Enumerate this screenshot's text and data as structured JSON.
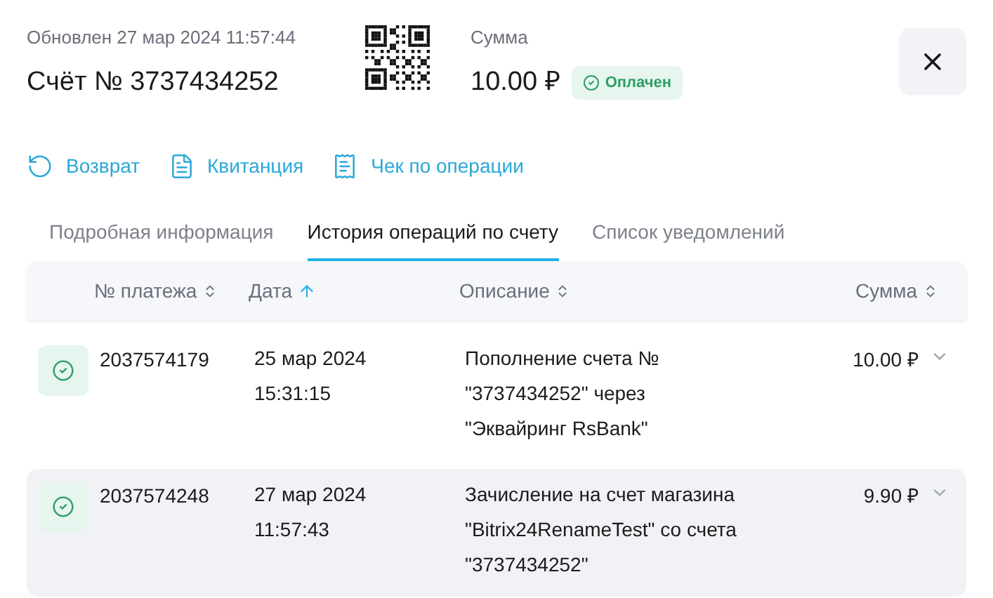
{
  "header": {
    "updated": "Обновлен 27 мар 2024 11:57:44",
    "title": "Счёт № 3737434252",
    "amount_label": "Сумма",
    "amount": "10.00 ₽",
    "status": "Оплачен"
  },
  "actions": [
    {
      "kind": "refund",
      "label": "Возврат"
    },
    {
      "kind": "receipt",
      "label": "Квитанция"
    },
    {
      "kind": "check",
      "label": "Чек по операции"
    }
  ],
  "tabs": [
    {
      "label": "Подробная информация",
      "selected": false
    },
    {
      "label": "История операций по счету",
      "selected": true
    },
    {
      "label": "Список уведомлений",
      "selected": false
    }
  ],
  "table": {
    "columns": [
      {
        "label": "№ платежа",
        "sorted": false
      },
      {
        "label": "Дата",
        "sorted": true
      },
      {
        "label": "Описание",
        "sorted": false
      },
      {
        "label": "Сумма",
        "sorted": false
      }
    ],
    "rows": [
      {
        "number": "2037574179",
        "date": "25 мар 2024",
        "time": "15:31:15",
        "description": "Пополнение счета № \"3737434252\" через \"Эквайринг RsBank\"",
        "amount": "10.00 ₽",
        "selected": false
      },
      {
        "number": "2037574248",
        "date": "27 мар 2024",
        "time": "11:57:43",
        "description": "Зачисление на счет магазина \"Bitrix24RenameTest\" со счета \"3737434252\"",
        "amount": "9.90 ₽",
        "selected": true
      }
    ]
  }
}
